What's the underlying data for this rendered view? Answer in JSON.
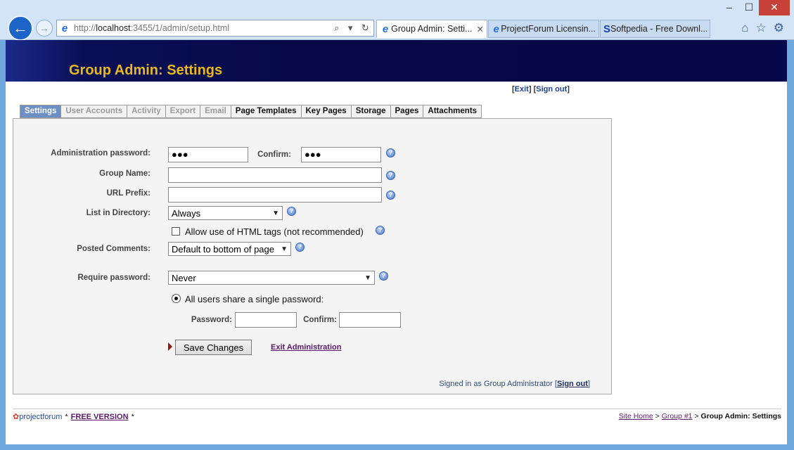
{
  "browser": {
    "url_base": "http://",
    "url_host": "localhost",
    "url_rest": ":3455/1/admin/setup.html",
    "tabs": [
      {
        "label": "Group Admin: Setti...",
        "close": "✕"
      },
      {
        "label": "ProjectForum Licensin..."
      },
      {
        "label": "Softpedia - Free Downl..."
      }
    ]
  },
  "banner": {
    "title": "Group Admin: Settings"
  },
  "toplinks": {
    "exit": "Exit",
    "signout": "Sign out"
  },
  "tabs": [
    "Settings",
    "User Accounts",
    "Activity",
    "Export",
    "Email",
    "Page Templates",
    "Key Pages",
    "Storage",
    "Pages",
    "Attachments"
  ],
  "form": {
    "admin_password_label": "Administration password:",
    "admin_password_value": "●●●",
    "confirm_label": "Confirm:",
    "confirm_value": "●●●",
    "group_name_label": "Group Name:",
    "group_name_value": "",
    "url_prefix_label": "URL Prefix:",
    "url_prefix_value": "",
    "list_dir_label": "List in Directory:",
    "list_dir_value": "Always",
    "html_tags_label": "Allow use of HTML tags (not recommended)",
    "posted_comments_label": "Posted Comments:",
    "posted_comments_value": "Default to bottom of page",
    "require_password_label": "Require password:",
    "require_password_value": "Never",
    "shared_password_label": "All users share a single password:",
    "password_label": "Password:",
    "password_confirm_label": "Confirm:",
    "save_label": "Save Changes",
    "exit_admin_label": "Exit Administration"
  },
  "signed": {
    "text": "Signed in as Group Administrator",
    "signout": "Sign out"
  },
  "footer": {
    "logo_project": "project",
    "logo_forum": "forum",
    "free_version": "FREE VERSION",
    "crumb_home": "Site Home",
    "crumb_group": "Group #1",
    "crumb_current": "Group Admin: Settings"
  }
}
